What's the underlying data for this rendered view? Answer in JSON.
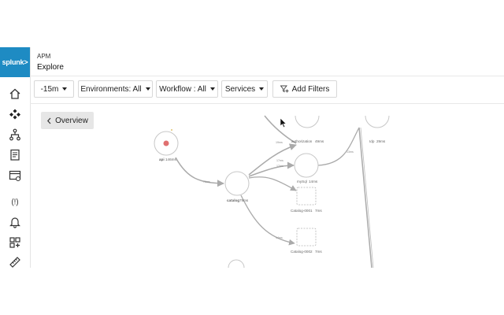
{
  "sidebar": {
    "logo_text": "splunk>"
  },
  "header": {
    "breadcrumb": "APM",
    "title": "Explore"
  },
  "toolbar": {
    "time_range": "-15m",
    "environments": "Environments: All",
    "workflow": "Workflow : All",
    "services": "Services",
    "add_filters": "Add Filters"
  },
  "canvas": {
    "overview_label": "Overview"
  },
  "graph": {
    "nodes": {
      "api": "api",
      "api_latency": "146ms",
      "catalog": "catalog",
      "catalog_latency": "79ms",
      "authorization": "authorization",
      "authorization_latency": "49ms",
      "mysql": "mySql",
      "mysql_latency": "14ms",
      "catalog_0001": "Catalog-0001",
      "catalog_0001_latency": "7ms",
      "catalog_0002": "Catalog-0002",
      "catalog_0002_latency": "7ms",
      "idp": "Idp",
      "idp_latency": "29ms"
    },
    "edges": {
      "api_catalog": "79ms",
      "catalog_auth": "19ms",
      "catalog_mysql_a": "17ms",
      "catalog_mysql_b": "17ms",
      "catalog_c2": "14ms",
      "mysql_idp": "13ms"
    }
  },
  "colors": {
    "accent": "#1e8bc3",
    "error_dot": "#e07070"
  }
}
